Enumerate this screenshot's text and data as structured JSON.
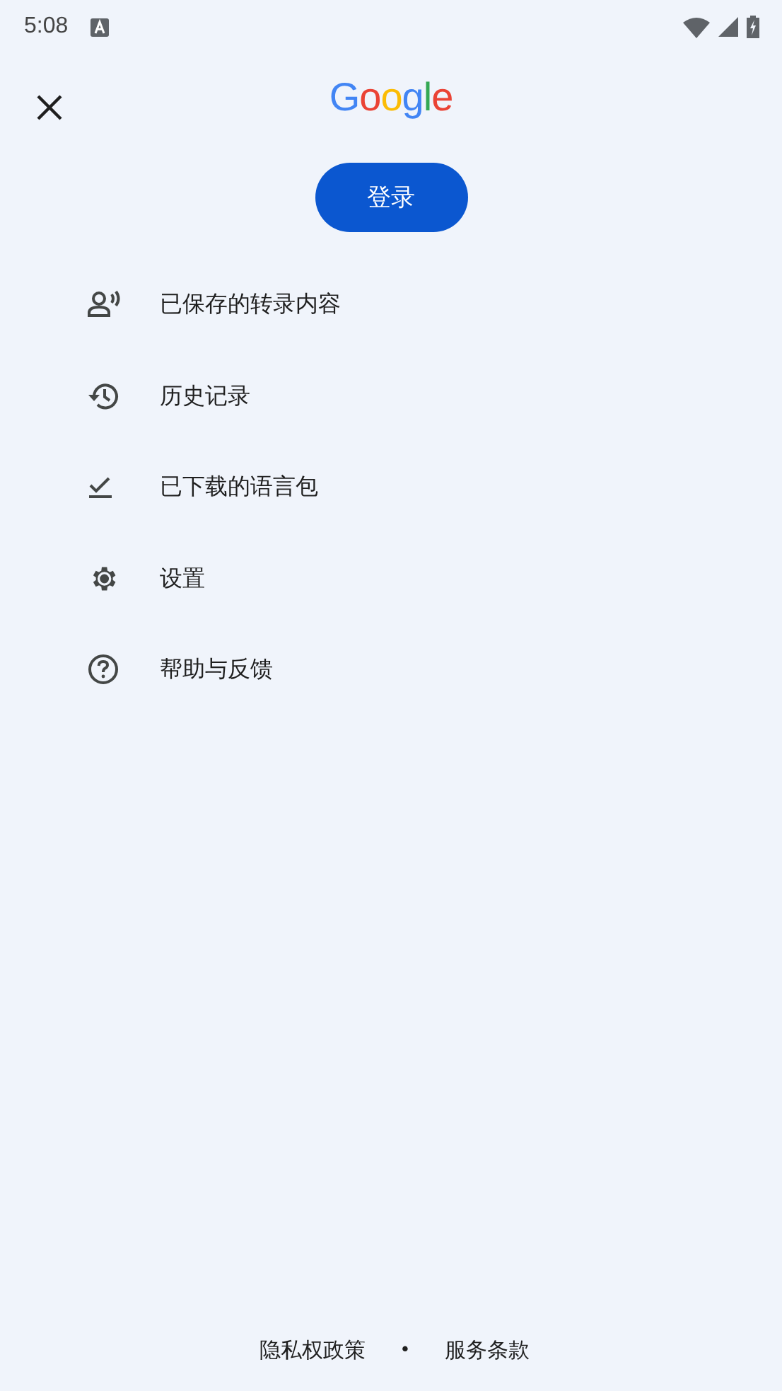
{
  "status_bar": {
    "time": "5:08"
  },
  "header": {
    "logo": "Google"
  },
  "sign_in_button": "登录",
  "menu": [
    {
      "kind": "transcripts",
      "label": "已保存的转录内容"
    },
    {
      "kind": "history",
      "label": "历史记录"
    },
    {
      "kind": "downloads",
      "label": "已下载的语言包"
    },
    {
      "kind": "settings",
      "label": "设置"
    },
    {
      "kind": "help",
      "label": "帮助与反馈"
    }
  ],
  "footer": {
    "links": [
      "隐私权政策",
      "服务条款"
    ],
    "separator": "•"
  }
}
